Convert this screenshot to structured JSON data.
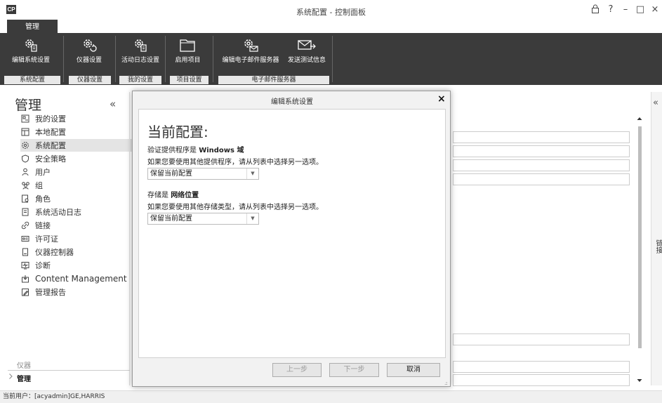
{
  "window": {
    "logo": "CP",
    "title": "系统配置 - 控制面板",
    "controls": [
      "lock-icon",
      "help-icon",
      "minimize-icon",
      "maximize-icon",
      "close-icon"
    ],
    "control_glyphs": {
      "help": "?",
      "minimize": "–",
      "maximize": "□",
      "close": "×"
    }
  },
  "ribbon": {
    "tab": "管理",
    "buttons": [
      {
        "label": "编辑系统设置",
        "icon": "gear-document-icon"
      },
      {
        "label": "仪器设置",
        "icon": "gear-refresh-icon"
      },
      {
        "label": "活动日志设置",
        "icon": "gear-document-icon"
      },
      {
        "label": "启用项目",
        "icon": "folder-icon"
      },
      {
        "label": "编辑电子邮件服务器",
        "icon": "gear-mail-icon"
      },
      {
        "label": "发送测试信息",
        "icon": "mail-send-icon"
      }
    ],
    "groups": [
      "系统配置",
      "仪器设置",
      "我的设置",
      "项目设置",
      "电子邮件服务器"
    ]
  },
  "sidebar": {
    "title": "管理",
    "collapse_glyph": "«",
    "items": [
      {
        "label": "我的设置",
        "icon": "my-settings-icon"
      },
      {
        "label": "本地配置",
        "icon": "local-config-icon"
      },
      {
        "label": "系统配置",
        "icon": "gear-icon",
        "active": true
      },
      {
        "label": "安全策略",
        "icon": "shield-icon"
      },
      {
        "label": "用户",
        "icon": "user-icon"
      },
      {
        "label": "组",
        "icon": "group-icon"
      },
      {
        "label": "角色",
        "icon": "role-icon"
      },
      {
        "label": "系统活动日志",
        "icon": "log-icon"
      },
      {
        "label": "链接",
        "icon": "link-icon"
      },
      {
        "label": "许可证",
        "icon": "license-icon"
      },
      {
        "label": "仪器控制器",
        "icon": "instrument-controller-icon"
      },
      {
        "label": "诊断",
        "icon": "diagnostics-icon"
      },
      {
        "label": "Content Management",
        "icon": "content-management-icon"
      },
      {
        "label": "管理报告",
        "icon": "report-icon"
      }
    ],
    "bottom_section": "仪器",
    "bottom_selected": "管理"
  },
  "right_panel": {
    "collapse_glyph": "«",
    "label": "链接"
  },
  "dialog": {
    "title": "编辑系统设置",
    "close_glyph": "×",
    "heading": "当前配置:",
    "auth_prefix": "验证提供程序是",
    "auth_value": "Windows 域",
    "auth_hint": "如果您要使用其他提供程序，请从列表中选择另一选项。",
    "auth_select": "保留当前配置",
    "storage_prefix": "存储是",
    "storage_value": "网络位置",
    "storage_hint": "如果您要使用其他存储类型，请从列表中选择另一选项。",
    "storage_select": "保留当前配置",
    "select_arrow": "▼",
    "buttons": {
      "prev": "上一步",
      "next": "下一步",
      "cancel": "取消"
    },
    "grip": ".::"
  },
  "status": {
    "text": "当前用户：[acyadmin]GE,HARRIS"
  },
  "colors": {
    "ribbon_bg": "#3b3b3b",
    "group_label_bg": "#e8e8e8",
    "active_item_bg": "#e4e4e4",
    "dialog_bg": "#f2f2f2"
  }
}
